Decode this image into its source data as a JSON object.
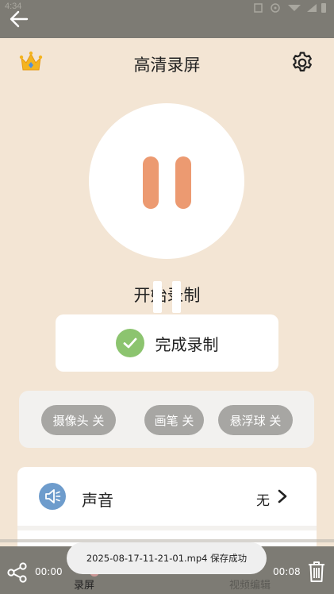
{
  "status_bar": {
    "time": "4:34"
  },
  "header": {
    "title": "高清录屏"
  },
  "record": {
    "start_label": "开始录制",
    "finish_label": "完成录制"
  },
  "toggles": [
    {
      "label": "摄像头 关"
    },
    {
      "label": "画笔 关"
    },
    {
      "label": "悬浮球 关"
    }
  ],
  "settings": {
    "sound": {
      "label": "声音",
      "value": "无"
    }
  },
  "player": {
    "current_time": "00:00",
    "total_time": "00:08"
  },
  "tabs": [
    {
      "label": "录屏"
    },
    {
      "label": "视频编辑"
    }
  ],
  "toast": {
    "message": "2025-08-17-11-21-01.mp4 保存成功"
  },
  "colors": {
    "background": "#f3e5d4",
    "pause_accent": "#ec9a71",
    "success": "#8cc46f",
    "pill": "#a7a6a3",
    "sound_icon": "#6e9ccc",
    "bar_dim": "#7d7b74"
  },
  "icons": [
    "back-arrow-icon",
    "crown-icon",
    "gear-icon",
    "pause-icon",
    "check-icon",
    "speaker-icon",
    "chevron-right-icon",
    "share-icon",
    "trash-icon"
  ]
}
